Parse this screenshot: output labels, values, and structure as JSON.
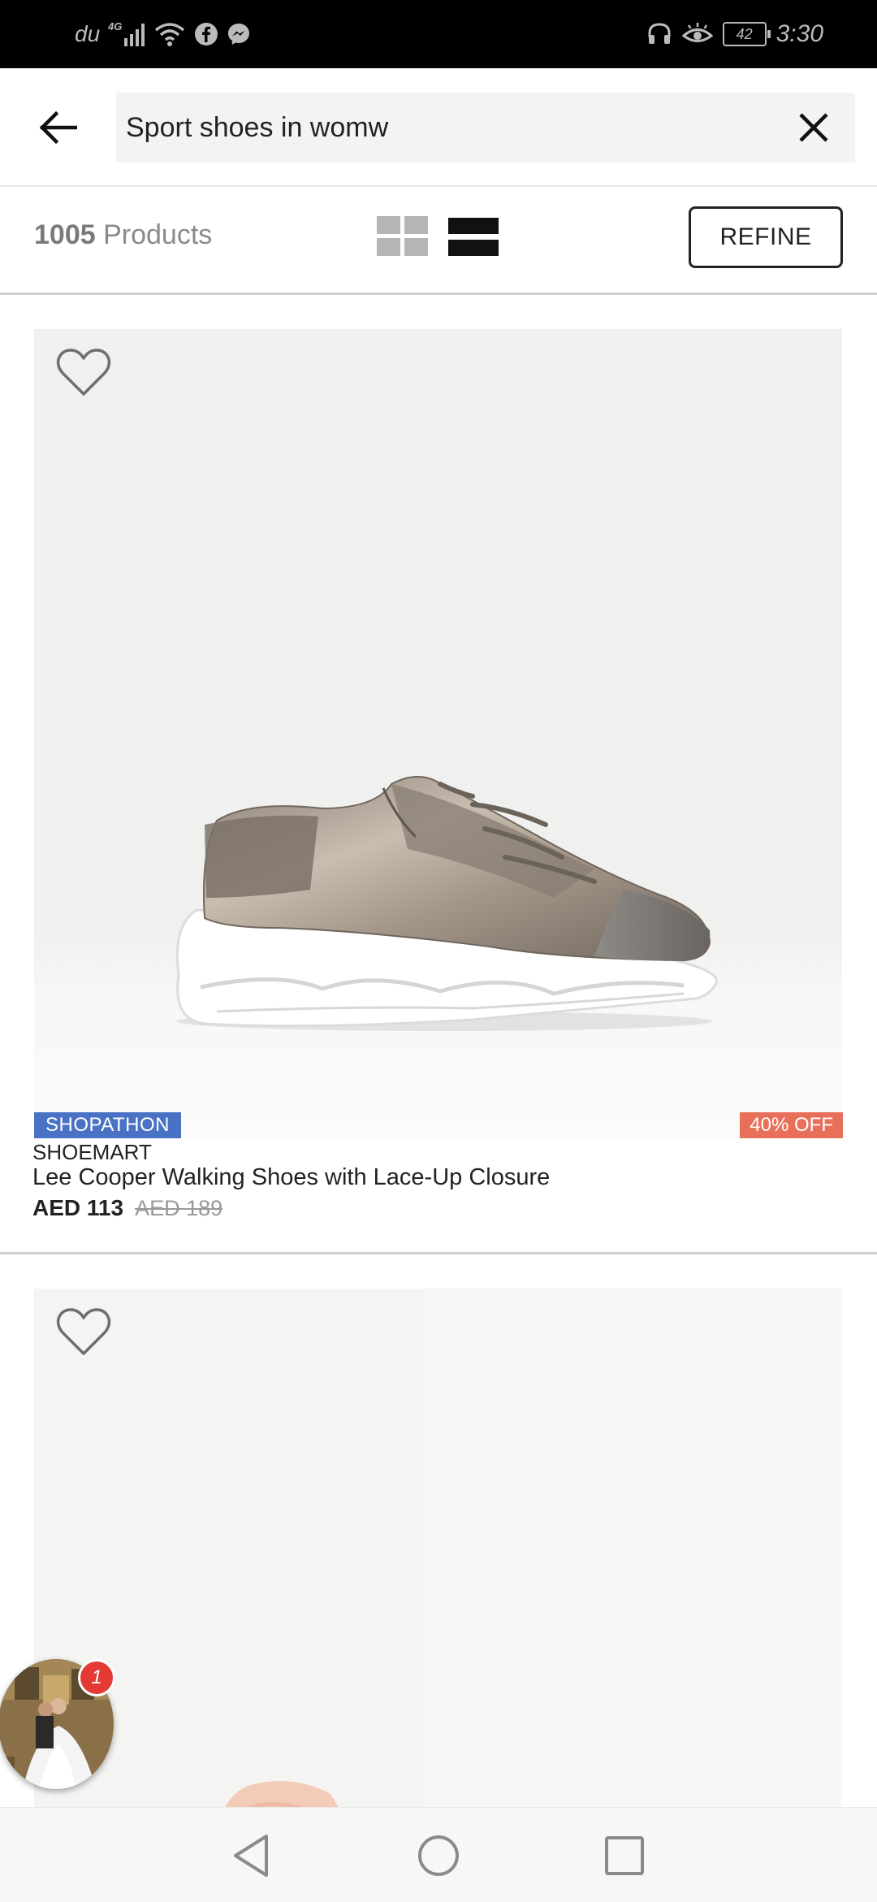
{
  "status_bar": {
    "carrier": "du",
    "network": "4G",
    "battery": "42",
    "time": "3:30",
    "icons": [
      "signal-icon",
      "wifi-icon",
      "facebook-icon",
      "messenger-icon",
      "headset-icon",
      "eye-comfort-icon",
      "battery-icon"
    ]
  },
  "search": {
    "query": "Sport shoes in womw",
    "back_icon": "arrow-left-icon",
    "clear_icon": "close-icon"
  },
  "results": {
    "count": "1005",
    "count_label": "Products",
    "grid_view_icon": "grid-view-icon",
    "list_view_icon": "list-view-icon",
    "active_view": "list",
    "refine_label": "REFINE"
  },
  "products": [
    {
      "promo_badge": "SHOPATHON",
      "discount": "40% OFF",
      "brand": "SHOEMART",
      "title": "Lee Cooper Walking Shoes with Lace-Up Closure",
      "price": "AED 113",
      "original_price": "AED 189",
      "wishlist_icon": "heart-outline-icon",
      "image": "metallic-sneaker-image"
    },
    {
      "wishlist_icon": "heart-outline-icon",
      "image": "pink-sneaker-image"
    }
  ],
  "chat_head": {
    "badge_count": "1"
  },
  "nav_bar": {
    "icons": [
      "nav-back-icon",
      "nav-home-icon",
      "nav-recents-icon"
    ]
  },
  "colors": {
    "promo_badge": "#4a72c4",
    "discount_badge": "#e86f59",
    "notification": "#e53935"
  }
}
